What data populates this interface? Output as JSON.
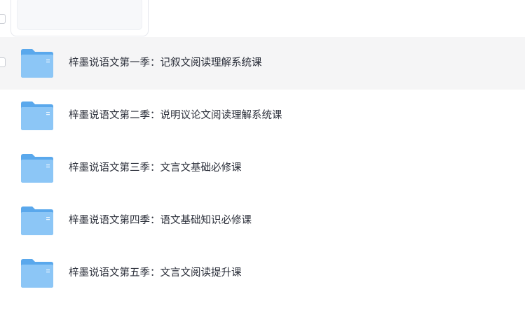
{
  "folders": [
    {
      "name": "梓墨说语文第一季：记叙文阅读理解系统课",
      "type": "folder-icon"
    },
    {
      "name": "梓墨说语文第二季：说明议论文阅读理解系统课",
      "type": "folder-icon"
    },
    {
      "name": "梓墨说语文第三季：文言文基础必修课",
      "type": "folder-icon"
    },
    {
      "name": "梓墨说语文第四季：语文基础知识必修课",
      "type": "folder-icon"
    },
    {
      "name": "梓墨说语文第五季：文言文阅读提升课",
      "type": "folder-icon"
    }
  ],
  "colors": {
    "hover_row": "#f5f5f6",
    "folder_back": "#5aa8ec",
    "folder_front": "#8cc6f6",
    "text": "#2b2f3a"
  }
}
